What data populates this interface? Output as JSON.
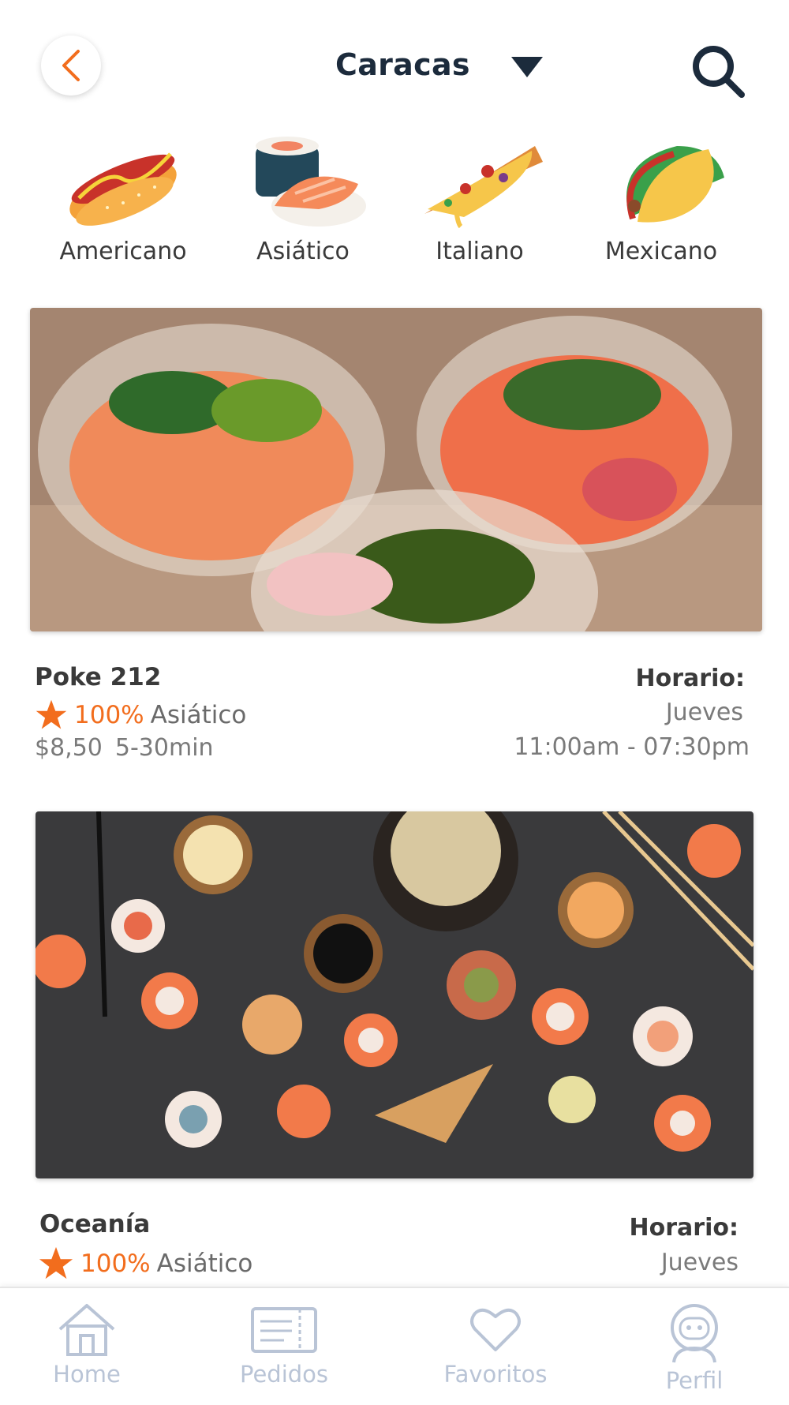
{
  "header": {
    "city": "Caracas",
    "back_icon": "chevron-left-icon",
    "dropdown_icon": "caret-down-icon",
    "search_icon": "search-icon"
  },
  "categories": [
    {
      "label": "Americano",
      "icon": "hotdog-icon"
    },
    {
      "label": "Asiático",
      "icon": "sushi-icon"
    },
    {
      "label": "Italiano",
      "icon": "pizza-icon"
    },
    {
      "label": "Mexicano",
      "icon": "taco-icon"
    }
  ],
  "restaurants": [
    {
      "name": "Poke 212",
      "rating": "100%",
      "cuisine": "Asiático",
      "price": "$8,50",
      "delivery_time": "5-30min",
      "schedule_label": "Horario:",
      "schedule_day": "Jueves",
      "schedule_hours": "11:00am - 07:30pm",
      "image": "poke-bowls-photo"
    },
    {
      "name": "Oceanía",
      "rating": "100%",
      "cuisine": "Asiático",
      "schedule_label": "Horario:",
      "schedule_day": "Jueves",
      "image": "sushi-platter-photo"
    }
  ],
  "nav": [
    {
      "label": "Home",
      "icon": "home-icon"
    },
    {
      "label": "Pedidos",
      "icon": "ticket-icon"
    },
    {
      "label": "Favoritos",
      "icon": "heart-icon"
    },
    {
      "label": "Perfil",
      "icon": "astronaut-icon"
    }
  ],
  "colors": {
    "accent": "#f26d1d",
    "title": "#1c2b3c",
    "nav_inactive": "#b9c4d6"
  }
}
